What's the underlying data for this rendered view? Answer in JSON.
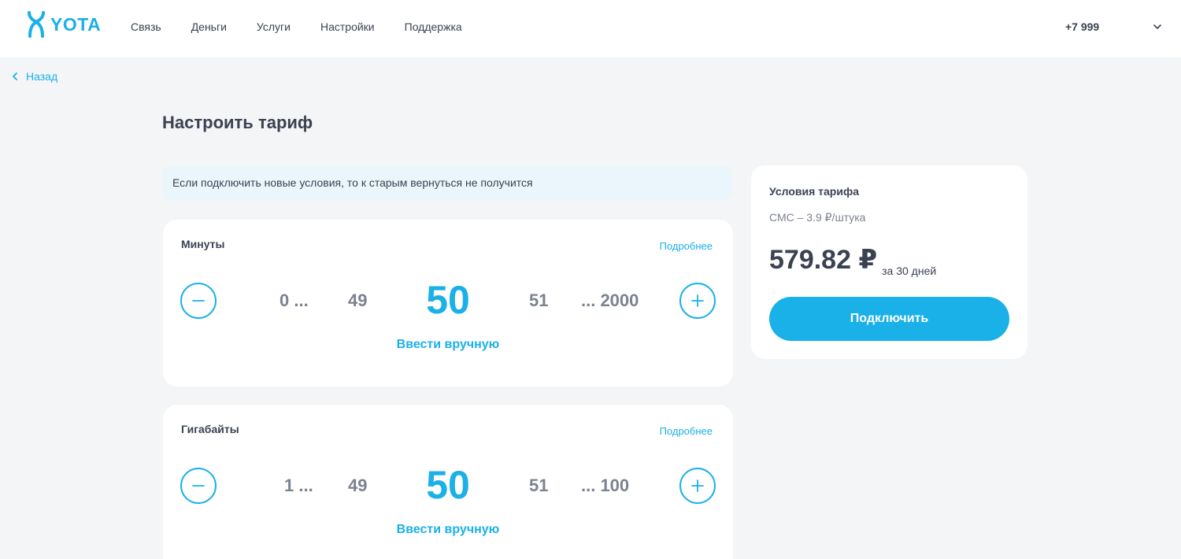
{
  "header": {
    "logo_text": "YOTA",
    "nav": [
      "Связь",
      "Деньги",
      "Услуги",
      "Настройки",
      "Поддержка"
    ],
    "phone": "+7 999"
  },
  "back_label": "Назад",
  "page_title": "Настроить тариф",
  "warning": "Если подключить новые условия, то к старым вернуться не получится",
  "minutes": {
    "title": "Минуты",
    "more": "Подробнее",
    "range_min": "0 ...",
    "prev": "49",
    "current": "50",
    "next": "51",
    "range_max": "... 2000",
    "manual": "Ввести вручную"
  },
  "gigabytes": {
    "title": "Гигабайты",
    "more": "Подробнее",
    "range_min": "1 ...",
    "prev": "49",
    "current": "50",
    "next": "51",
    "range_max": "... 100",
    "manual": "Ввести вручную"
  },
  "summary": {
    "title": "Условия тарифа",
    "sms": "СМС – 3.9 ₽/штука",
    "price": "579.82 ₽",
    "period": "за 30 дней",
    "connect": "Подключить"
  },
  "colors": {
    "accent": "#1ab0e8",
    "text": "#3a4252",
    "muted": "#7b8290",
    "background": "#f4f5f7"
  }
}
